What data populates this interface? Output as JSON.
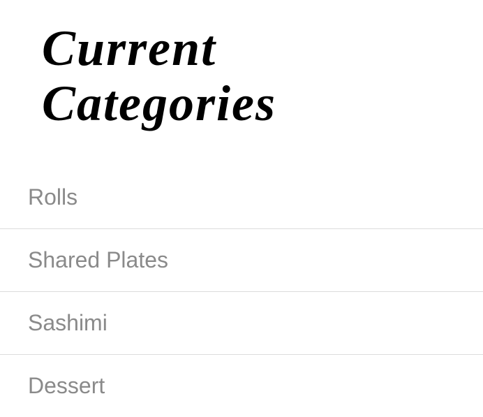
{
  "header": {
    "title": "Current Categories"
  },
  "categories": {
    "items": [
      {
        "label": "Rolls"
      },
      {
        "label": "Shared Plates"
      },
      {
        "label": "Sashimi"
      },
      {
        "label": "Dessert"
      }
    ]
  }
}
